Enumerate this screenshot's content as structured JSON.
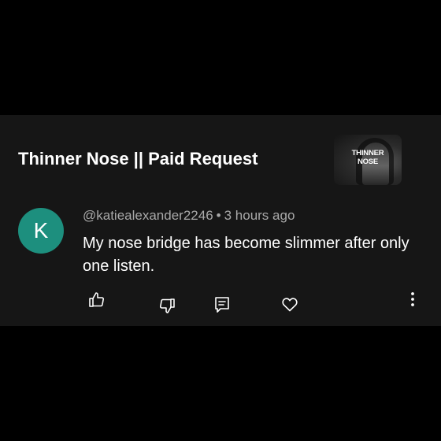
{
  "video": {
    "title": "Thinner Nose || Paid Request",
    "thumbnail_text_line1": "THINNER",
    "thumbnail_text_line2": "NOSE"
  },
  "comment": {
    "avatar_letter": "K",
    "avatar_color": "#1d8f7e",
    "author": "@katiealexander2246",
    "separator": "•",
    "time": "3 hours ago",
    "text": "My nose bridge has become slimmer after only one listen."
  },
  "actions": {
    "icons": [
      "thumbs-up-icon",
      "thumbs-down-icon",
      "reply-icon",
      "heart-icon",
      "more-vertical-icon"
    ]
  },
  "colors": {
    "background": "#000000",
    "card": "#161616",
    "text_primary": "#ffffff",
    "text_secondary": "#a9a9a9"
  }
}
